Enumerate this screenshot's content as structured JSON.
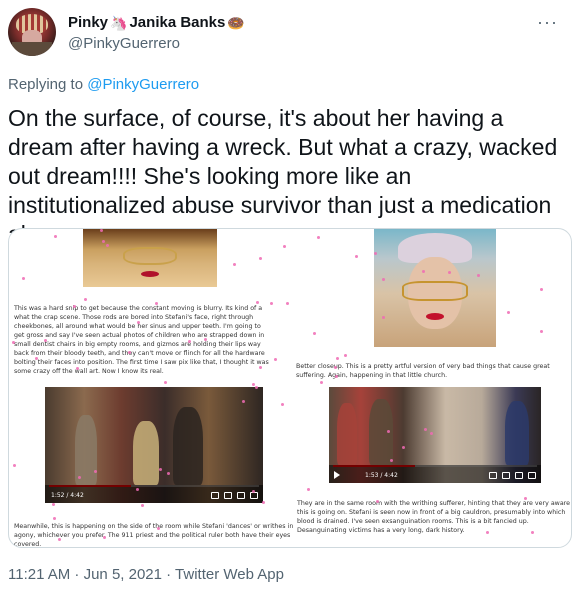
{
  "author": {
    "display_name": "Pinky",
    "display_name_2": "Janika Banks",
    "emoji_1": "🦄",
    "emoji_2": "🍩",
    "handle": "@PinkyGuerrero"
  },
  "more_label": "···",
  "reply": {
    "prefix": "Replying to ",
    "to": "@PinkyGuerrero"
  },
  "tweet_text": "On the surface, of course, it's about her having a dream after having a wreck. But what a crazy, wacked out dream!!!! She's looking more like an institutionalized abuse survivor than just a medication abuser.",
  "media": {
    "caption_1": "This was a hard snip to get because the constant moving is blurry. Its kind of a what the crap scene. Those rods are bored into Stefani's face, right through cheekbones, all around what would be her sinus and upper teeth. I'm going to get gross and say I've seen actual photos of children who are strapped down in small dentist chairs in big empty rooms, and gizmos are holding their lips way back from their bloody teeth, and they can't move or flinch for all the hardware bolting their faces into position. The first time I saw pix like that, I thought it was some crazy off the wall art. Now I know its real.",
    "caption_2": "Better closeup. This is a pretty artful version of very bad things that cause great suffering. Again, happening in that little church.",
    "caption_3": "Meanwhile, this is happening on the side of the room while Stefani 'dances' or writhes in agony, whichever you prefer. The 911 priest and the political ruler both have their eyes covered.",
    "caption_4": "They are in the same room with the writhing sufferer, hinting that they are very aware this is going on. Stefani is seen now in front of a big cauldron, presumably into which blood is drained. I've seen exsanguination rooms. This is a bit fancied up. Desanguinating victims has a very long, dark history.",
    "video_1_time": "1:52 / 4:42",
    "video_1_progress": 0.39,
    "video_2_time": "1:53 / 4:42",
    "video_2_progress": 0.4
  },
  "footer": "11:21 AM · Jun 5, 2021 · Twitter Web App",
  "colors": {
    "link": "#1d9bf0",
    "muted": "#536471",
    "text": "#0f1419",
    "sparkle": "#f06bb4"
  }
}
